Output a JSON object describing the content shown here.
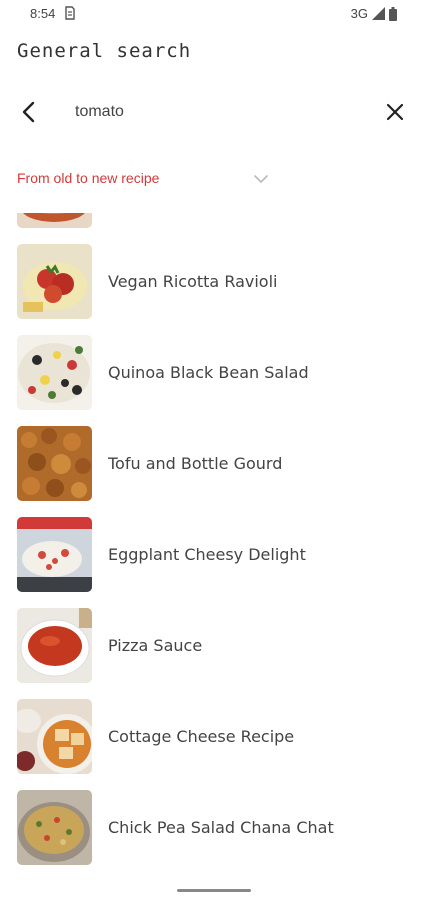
{
  "status": {
    "time": "8:54",
    "network": "3G"
  },
  "header": {
    "title": "General search"
  },
  "search": {
    "value": "tomato"
  },
  "sort": {
    "label": "From old to new recipe"
  },
  "recipes": [
    {
      "title": ""
    },
    {
      "title": "Vegan Ricotta Ravioli"
    },
    {
      "title": "Quinoa Black Bean Salad"
    },
    {
      "title": "Tofu and Bottle Gourd"
    },
    {
      "title": "Eggplant Cheesy Delight"
    },
    {
      "title": "Pizza Sauce"
    },
    {
      "title": "Cottage Cheese Recipe"
    },
    {
      "title": "Chick Pea Salad Chana Chat"
    }
  ],
  "colors": {
    "accent": "#d23a3a"
  }
}
